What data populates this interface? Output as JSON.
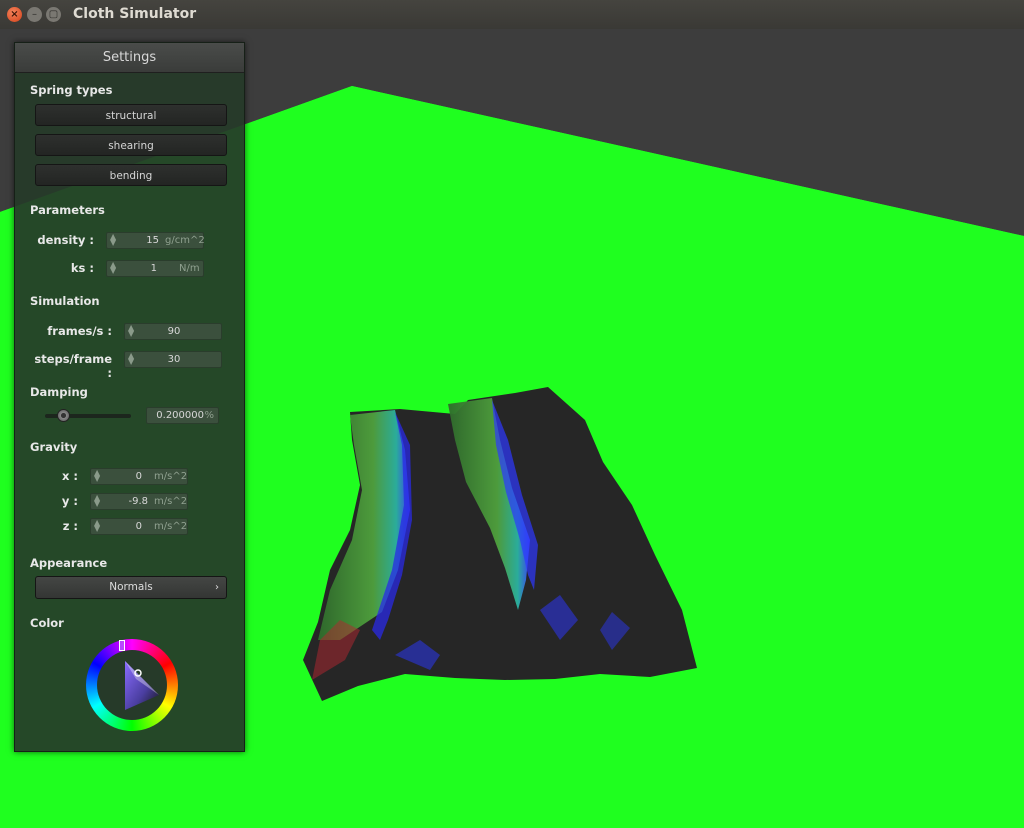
{
  "window": {
    "title": "Cloth Simulator"
  },
  "colors": {
    "floor": "#1fff1f",
    "background": "#3d3d3d",
    "panel": "#263a29",
    "close_button": "#e2562b"
  },
  "panel": {
    "title": "Settings",
    "spring_types": {
      "heading": "Spring types",
      "buttons": [
        "structural",
        "shearing",
        "bending"
      ]
    },
    "parameters": {
      "heading": "Parameters",
      "density": {
        "label": "density :",
        "value": "15",
        "unit": "g/cm^2"
      },
      "ks": {
        "label": "ks :",
        "value": "1",
        "unit": "N/m"
      }
    },
    "simulation": {
      "heading": "Simulation",
      "fps": {
        "label": "frames/s :",
        "value": "90"
      },
      "steps": {
        "label": "steps/frame :",
        "value": "30"
      }
    },
    "damping": {
      "heading": "Damping",
      "value": "0.200000",
      "unit": "%",
      "slider_fraction": 0.2
    },
    "gravity": {
      "heading": "Gravity",
      "x": {
        "label": "x :",
        "value": "0",
        "unit": "m/s^2"
      },
      "y": {
        "label": "y :",
        "value": "-9.8",
        "unit": "m/s^2"
      },
      "z": {
        "label": "z :",
        "value": "0",
        "unit": "m/s^2"
      }
    },
    "appearance": {
      "heading": "Appearance",
      "selected": "Normals"
    },
    "color": {
      "heading": "Color"
    }
  }
}
